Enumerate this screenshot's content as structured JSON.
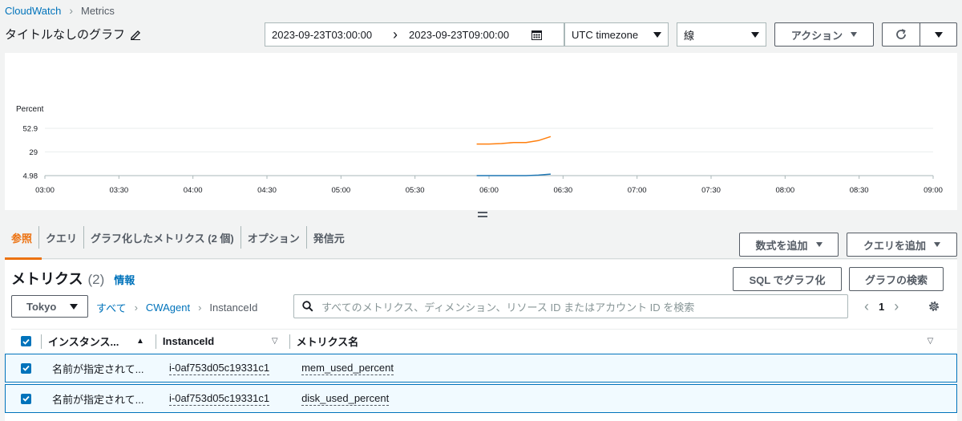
{
  "breadcrumb": {
    "root": "CloudWatch",
    "current": "Metrics"
  },
  "title": "タイトルなしのグラフ",
  "toolbar": {
    "start_time": "2023-09-23T03:00:00",
    "end_time": "2023-09-23T09:00:00",
    "timezone": "UTC timezone",
    "graph_type": "線",
    "actions_label": "アクション"
  },
  "chart_data": {
    "type": "line",
    "ylabel": "Percent",
    "y_ticks": [
      "52.9",
      "29",
      "4.98"
    ],
    "x_ticks": [
      "03:00",
      "03:30",
      "04:00",
      "04:30",
      "05:00",
      "05:30",
      "06:00",
      "06:30",
      "07:00",
      "07:30",
      "08:00",
      "08:30",
      "09:00"
    ],
    "ylim": [
      4.98,
      52.9
    ],
    "series": [
      {
        "color": "#ff7f0e",
        "x": [
          "05:55",
          "06:00",
          "06:05",
          "06:10",
          "06:15",
          "06:20",
          "06:25"
        ],
        "values": [
          37.0,
          37.0,
          37.5,
          38.5,
          38.5,
          40.5,
          44.5
        ]
      },
      {
        "color": "#1f77b4",
        "x": [
          "05:55",
          "06:00",
          "06:05",
          "06:10",
          "06:15",
          "06:20",
          "06:25"
        ],
        "values": [
          5.0,
          5.0,
          5.0,
          5.0,
          5.0,
          5.5,
          6.5
        ]
      }
    ]
  },
  "tabs": [
    "参照",
    "クエリ",
    "グラフ化したメトリクス (2 個)",
    "オプション",
    "発信元"
  ],
  "buttons": {
    "add_math": "数式を追加",
    "add_query": "クエリを追加",
    "graph_sql": "SQL でグラフ化",
    "graph_search": "グラフの検索"
  },
  "metrics": {
    "title": "メトリクス",
    "count": "(2)",
    "info": "情報",
    "region": "Tokyo",
    "crumbs": [
      "すべて",
      "CWAgent",
      "InstanceId"
    ],
    "search_placeholder": "すべてのメトリクス、ディメンション、リソース ID またはアカウント ID を検索",
    "page": "1",
    "columns": [
      "インスタンス...",
      "InstanceId",
      "メトリクス名"
    ],
    "rows": [
      {
        "name": "名前が指定されて...",
        "instance_id": "i-0af753d05c19331c1",
        "metric": "mem_used_percent"
      },
      {
        "name": "名前が指定されて...",
        "instance_id": "i-0af753d05c19331c1",
        "metric": "disk_used_percent"
      }
    ]
  }
}
